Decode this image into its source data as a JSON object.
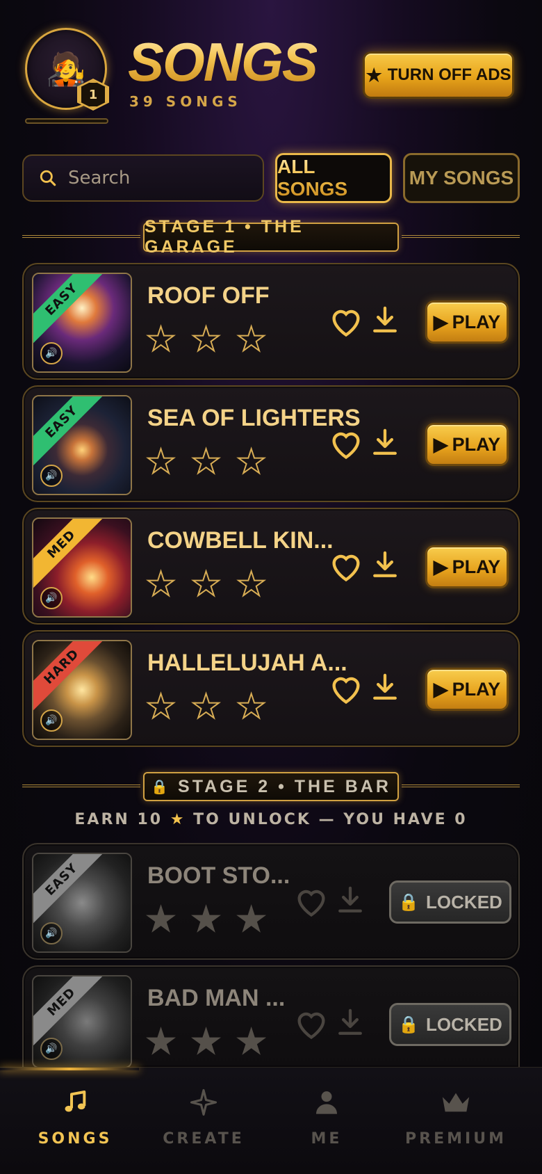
{
  "header": {
    "title": "SONGS",
    "subtitle": "39 SONGS",
    "avatar_emoji": "🧑‍🎤",
    "level": "1",
    "ads_button": "TURN OFF ADS"
  },
  "search": {
    "placeholder": "Search"
  },
  "filters": {
    "all_songs": "ALL SONGS",
    "my_songs": "MY SONGS",
    "selected": "ALL SONGS"
  },
  "stage1": {
    "label": "STAGE 1 • THE GARAGE"
  },
  "stage2": {
    "label": "STAGE 2 • THE BAR",
    "unlock_prefix": "EARN 10",
    "unlock_star": "★",
    "unlock_suffix": "TO UNLOCK — YOU HAVE 0"
  },
  "songs": [
    {
      "name": "ROOF OFF",
      "difficulty": "EASY",
      "play": "PLAY",
      "locked": false
    },
    {
      "name": "SEA OF LIGHTERS",
      "difficulty": "EASY",
      "play": "PLAY",
      "locked": false
    },
    {
      "name": "COWBELL KIN...",
      "difficulty": "MED",
      "play": "PLAY",
      "locked": false
    },
    {
      "name": "HALLELUJAH A...",
      "difficulty": "HARD",
      "play": "PLAY",
      "locked": false
    },
    {
      "name": "BOOT STO...",
      "difficulty": "EASY",
      "play": "LOCKED",
      "locked": true
    },
    {
      "name": "BAD MAN ...",
      "difficulty": "MED",
      "play": "LOCKED",
      "locked": true
    }
  ],
  "nav": {
    "songs": "SONGS",
    "create": "CREATE",
    "me": "ME",
    "premium": "PREMIUM",
    "active": "SONGS"
  },
  "colors": {
    "gold": "#f2c14e",
    "easy": "#2fbf71",
    "med": "#f2b632",
    "hard": "#e04a3a",
    "locked_gray": "#8a8a8a"
  }
}
